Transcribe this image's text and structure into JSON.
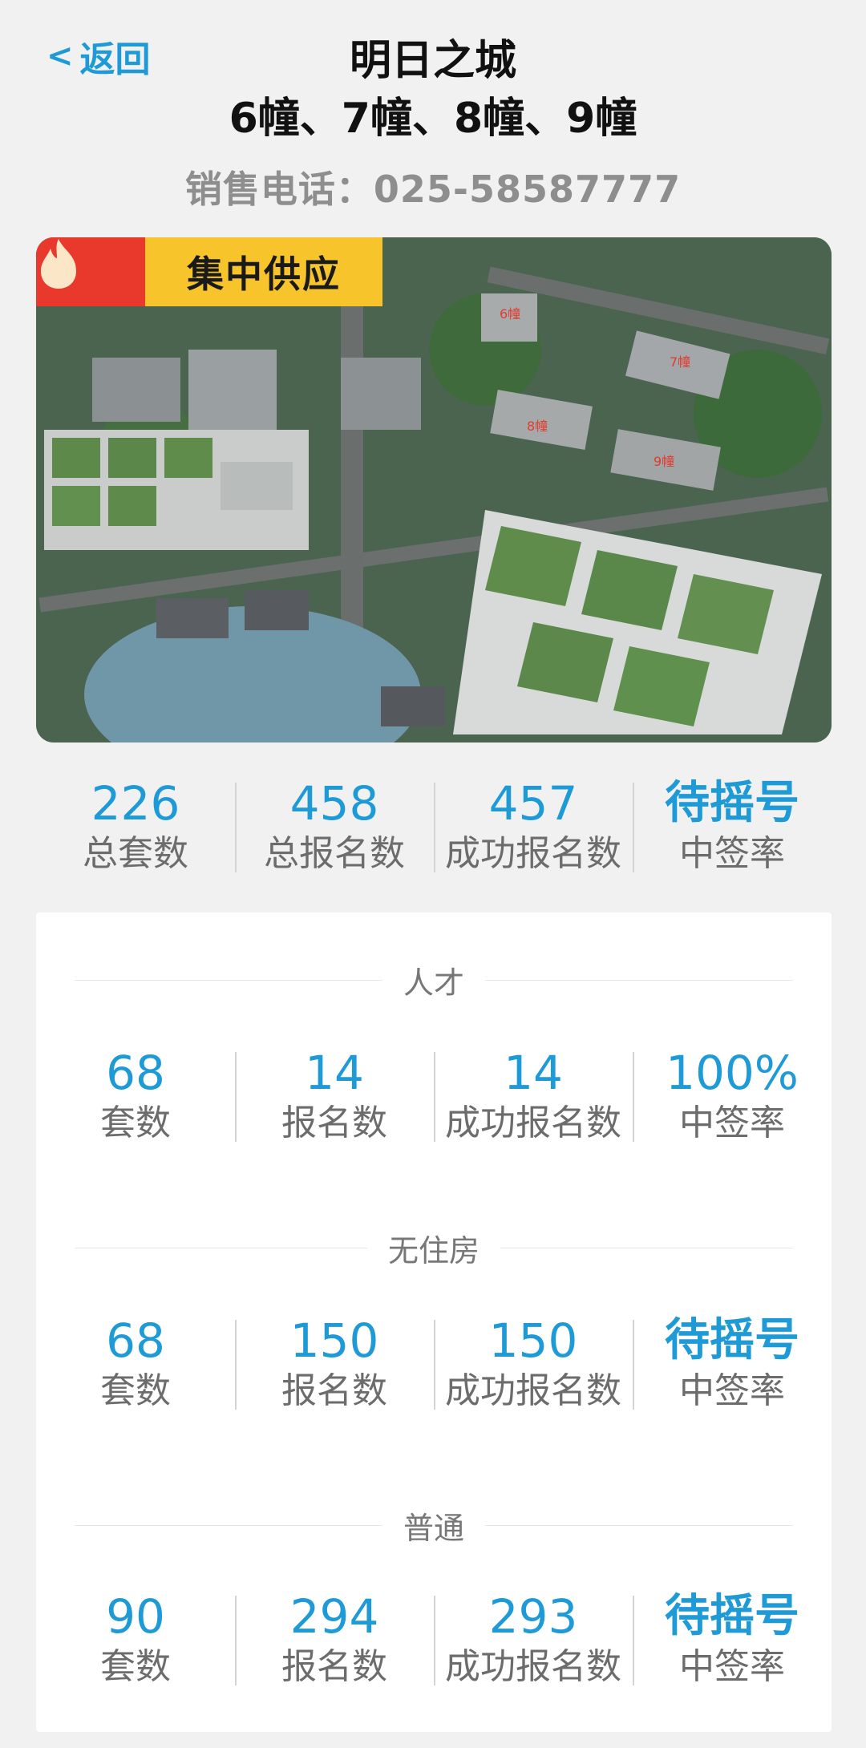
{
  "header": {
    "back_label": "返回",
    "title_line1": "明日之城",
    "title_line2": "6幢、7幢、8幢、9幢",
    "phone": "销售电话：025-58587777"
  },
  "hero": {
    "badge_text": "集中供应",
    "badge_icon": "flame-icon",
    "building_labels": [
      "6幢",
      "7幢",
      "8幢",
      "9幢"
    ],
    "colors": {
      "badge_bg": "#f7c52b",
      "badge_icon_bg": "#e8392c"
    }
  },
  "summary": {
    "total_units": {
      "value": "226",
      "label": "总套数"
    },
    "total_applicants": {
      "value": "458",
      "label": "总报名数"
    },
    "successful_applicants": {
      "value": "457",
      "label": "成功报名数"
    },
    "win_rate": {
      "value": "待摇号",
      "label": "中签率"
    }
  },
  "sections": [
    {
      "name": "人才",
      "units": {
        "value": "68",
        "label": "套数"
      },
      "applicants": {
        "value": "14",
        "label": "报名数"
      },
      "successful": {
        "value": "14",
        "label": "成功报名数"
      },
      "rate": {
        "value": "100%",
        "label": "中签率"
      }
    },
    {
      "name": "无住房",
      "units": {
        "value": "68",
        "label": "套数"
      },
      "applicants": {
        "value": "150",
        "label": "报名数"
      },
      "successful": {
        "value": "150",
        "label": "成功报名数"
      },
      "rate": {
        "value": "待摇号",
        "label": "中签率"
      }
    },
    {
      "name": "普通",
      "units": {
        "value": "90",
        "label": "套数"
      },
      "applicants": {
        "value": "294",
        "label": "报名数"
      },
      "successful": {
        "value": "293",
        "label": "成功报名数"
      },
      "rate": {
        "value": "待摇号",
        "label": "中签率"
      }
    }
  ],
  "colors": {
    "accent": "#1e9bd7",
    "label": "#6c6c6c",
    "background": "#f1f1f1"
  }
}
